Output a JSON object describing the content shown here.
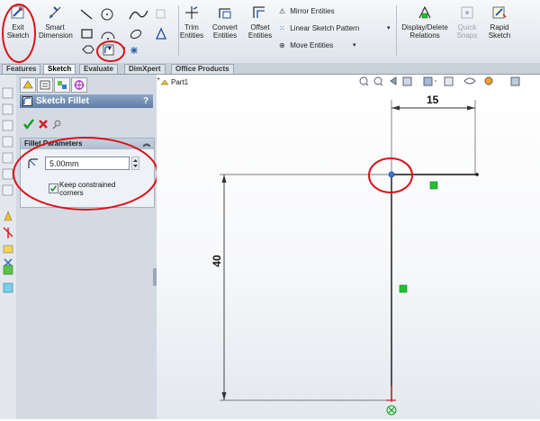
{
  "ribbon": {
    "exit_sketch": "Exit Sketch",
    "smart_dimension": "Smart Dimension",
    "trim_entities": "Trim Entities",
    "convert_entities": "Convert Entities",
    "offset_entities": "Offset Entities",
    "mirror_entities": "Mirror Entities",
    "linear_sketch_pattern": "Linear Sketch Pattern",
    "move_entities": "Move Entities",
    "display_delete_relations": "Display/Delete Relations",
    "quick_snaps": "Quick Snaps",
    "rapid_sketch": "Rapid Sketch"
  },
  "tabs": [
    "Features",
    "Sketch",
    "Evaluate",
    "DimXpert",
    "Office Products"
  ],
  "tree": {
    "part_label": "Part1"
  },
  "property_manager": {
    "title": "Sketch Fillet",
    "help": "?",
    "group_title": "Fillet Parameters",
    "radius_value": "5.00mm",
    "keep_corners_line1": "Keep constrained",
    "keep_corners_line2": "corners",
    "keep_corners_checked": true
  },
  "sketch": {
    "horizontal_dim": "15",
    "vertical_dim": "40"
  },
  "colors": {
    "highlight_circle": "#d8141a",
    "relation_marker": "#1fc42e",
    "selected_point": "#3a78d0"
  }
}
